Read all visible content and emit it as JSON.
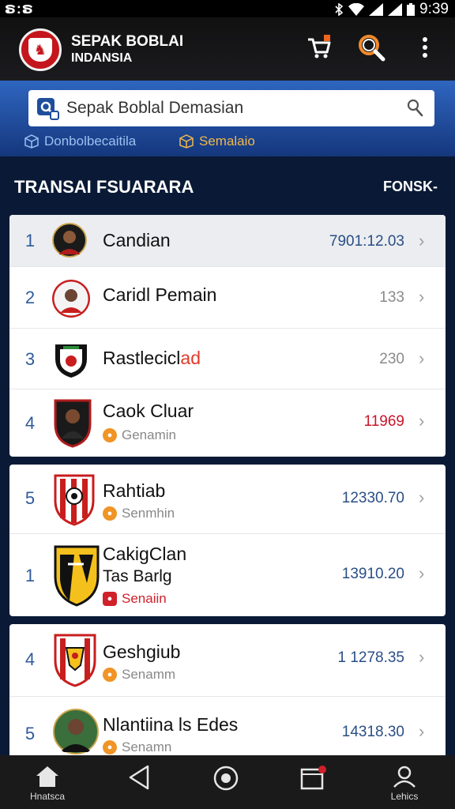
{
  "status": {
    "left_text": "ຣ:ຣ",
    "time": "9:39"
  },
  "app": {
    "title_line1": "SEPAK BOBLAI",
    "title_line2": "INDANSIA"
  },
  "search": {
    "placeholder": "Sepak Boblal Demasian"
  },
  "filters": [
    {
      "label": "Donbolbecaitila"
    },
    {
      "label": "Semalaio"
    }
  ],
  "section": {
    "title": "TRANSAI FSUARARA",
    "action": "FONSK-"
  },
  "rows": [
    {
      "rank": "1",
      "name": "Candian",
      "value": "7901:12.03"
    },
    {
      "rank": "2",
      "name": "Caridl Pemain",
      "value": "133"
    },
    {
      "rank": "3",
      "name_main": "Rastlecicl",
      "name_red": "ad",
      "value": "230"
    },
    {
      "rank": "4",
      "name": "Caok Cluar",
      "sub": "Genamin",
      "value": "11969"
    },
    {
      "rank": "5",
      "name": "Rahtiab",
      "sub": "Senmhin",
      "value": "12330.70"
    },
    {
      "rank": "1",
      "name": "CakigClan",
      "name_line2": "Tas Barlg",
      "sub": "Senaiin",
      "value": "13910.20"
    },
    {
      "rank": "4",
      "name": "Geshgiub",
      "sub": "Senamm",
      "value": "1 1278.35"
    },
    {
      "rank": "5",
      "name": "Nlantiina ls Edes",
      "sub": "Senamn",
      "value": "14318.30"
    }
  ],
  "nav": [
    {
      "label": "Hnatsca",
      "icon": "home-icon"
    },
    {
      "label": "",
      "icon": "back-triangle-icon"
    },
    {
      "label": "",
      "icon": "circle-home-icon"
    },
    {
      "label": "",
      "icon": "inbox-icon"
    },
    {
      "label": "Lehics",
      "icon": "profile-icon"
    }
  ]
}
